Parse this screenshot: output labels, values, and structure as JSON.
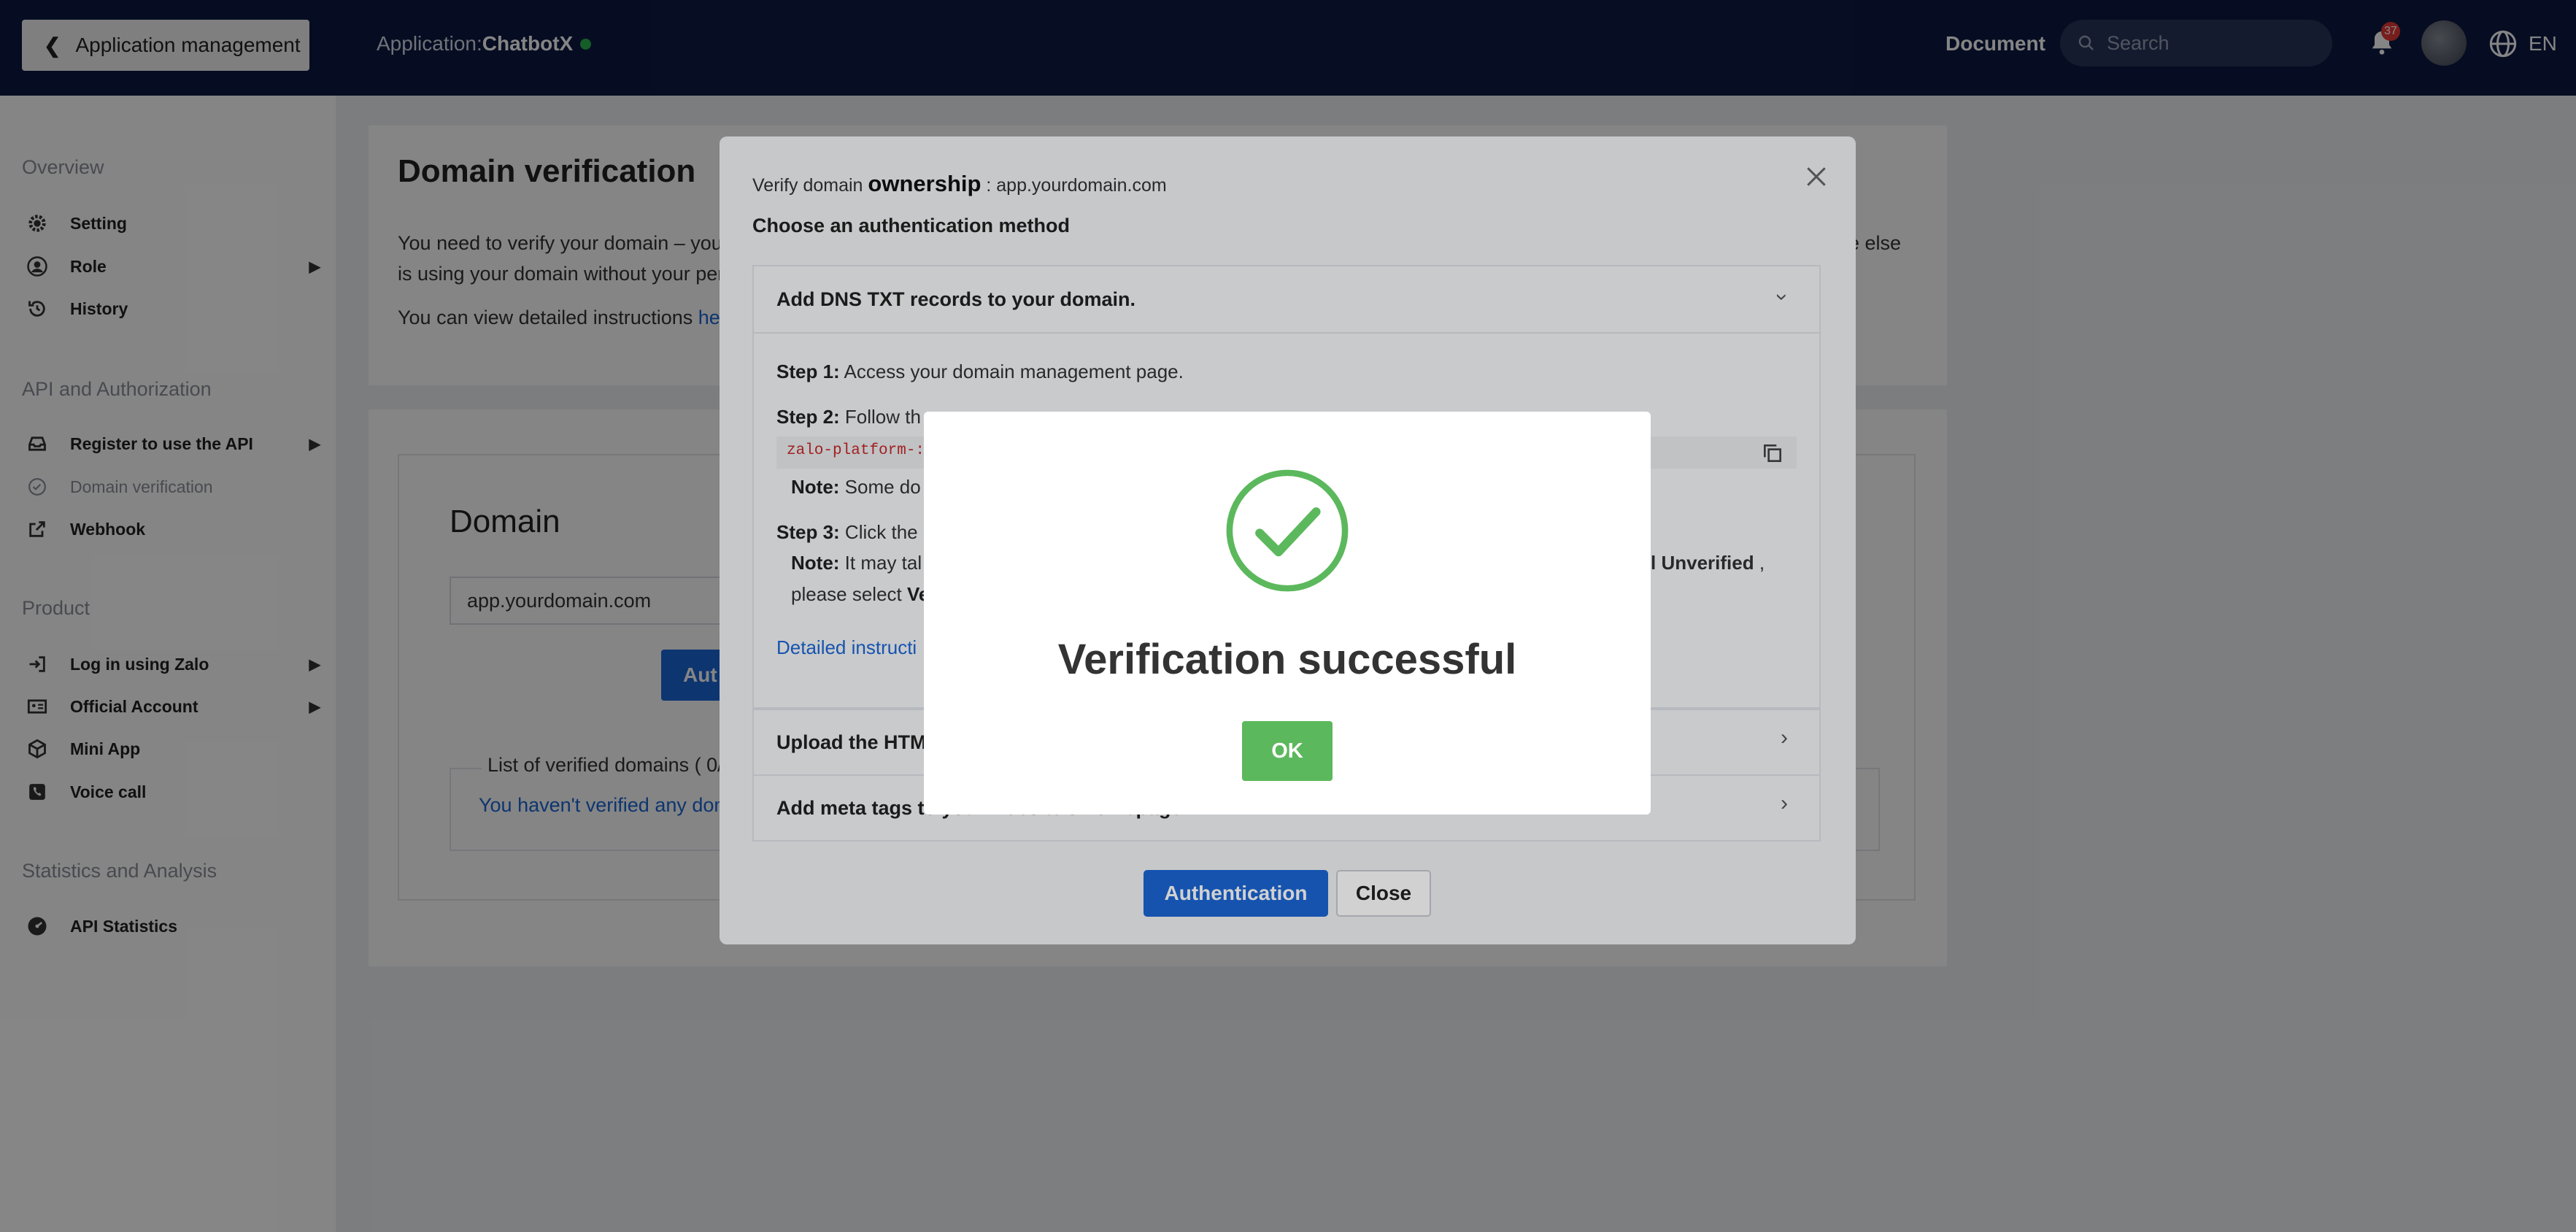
{
  "topbar": {
    "back_label": "Application management",
    "app_prefix": "Application:",
    "app_name": "ChatbotX",
    "document_label": "Document",
    "search_placeholder": "Search",
    "notification_count": "37",
    "language": "EN"
  },
  "sidebar": {
    "sections": [
      {
        "title": "Overview"
      },
      {
        "title": "API and Authorization"
      },
      {
        "title": "Product"
      },
      {
        "title": "Statistics and Analysis"
      }
    ],
    "items": [
      {
        "label": "Setting",
        "icon": "gear-icon"
      },
      {
        "label": "Role",
        "icon": "user-icon"
      },
      {
        "label": "History",
        "icon": "history-icon"
      },
      {
        "label": "Register to use the API",
        "icon": "inbox-icon"
      },
      {
        "label": "Domain verification",
        "icon": "check-circle-icon"
      },
      {
        "label": "Webhook",
        "icon": "external-link-icon"
      },
      {
        "label": "Log in using Zalo",
        "icon": "login-icon"
      },
      {
        "label": "Official Account",
        "icon": "id-card-icon"
      },
      {
        "label": "Mini App",
        "icon": "cube-icon"
      },
      {
        "label": "Voice call",
        "icon": "phone-icon"
      },
      {
        "label": "API Statistics",
        "icon": "dashboard-icon"
      }
    ]
  },
  "main": {
    "title": "Domain verification",
    "desc_line1_start": "You need to verify your domain – your",
    "desc_line1_end": "e else",
    "desc_line2": "is using your domain without your per",
    "desc3_text": "You can view detailed instructions",
    "desc3_link": "he",
    "domain_title": "Domain",
    "domain_value": "app.yourdomain.com",
    "auth_partial": "Aut",
    "verified_label": "List of verified domains ( 0/",
    "not_verified": "You haven't verified any dom"
  },
  "modal": {
    "verify_prefix": "Verify domain ",
    "verify_bold": "ownership",
    "verify_domain": " : app.yourdomain.com",
    "choose_label": "Choose an authentication method",
    "acc1_title": "Add DNS TXT records to your domain.",
    "step1_label": "Step 1:",
    "step1_text": " Access your domain management page.",
    "step2_label": "Step 2:",
    "step2_text": " Follow th",
    "code_partial": "zalo-platform-:",
    "note1_label": "Note:",
    "note1_text": " Some do",
    "step3_label": "Step 3:",
    "step3_text": " Click the '",
    "note2_label": "Note:",
    "note2_text": " It may tal",
    "note2_bold_end": "l Unverified",
    "note2_end": " ,",
    "note2_line2_text": "please select ",
    "note2_line2_bold": "Ve",
    "detail_link": "Detailed instructi",
    "acc2_title": "Upload the HTM",
    "acc3_title": "Add meta tags to your website's homepage.",
    "authentication_button": "Authentication",
    "close_button": "Close"
  },
  "success": {
    "message": "Verification successful",
    "ok_label": "OK",
    "color": "#5cb85c"
  }
}
